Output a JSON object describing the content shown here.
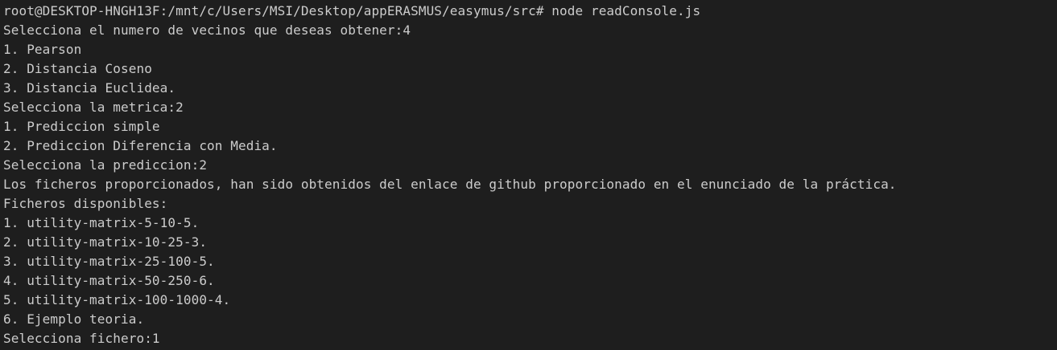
{
  "terminal": {
    "background": "#1e1e1e",
    "foreground": "#cccccc",
    "lines": [
      "root@DESKTOP-HNGH13F:/mnt/c/Users/MSI/Desktop/appERASMUS/easymus/src# node readConsole.js",
      "Selecciona el numero de vecinos que deseas obtener:4",
      "1. Pearson",
      "2. Distancia Coseno",
      "3. Distancia Euclidea.",
      "Selecciona la metrica:2",
      "1. Prediccion simple",
      "2. Prediccion Diferencia con Media.",
      "Selecciona la prediccion:2",
      "Los ficheros proporcionados, han sido obtenidos del enlace de github proporcionado en el enunciado de la práctica.",
      "Ficheros disponibles:",
      "1. utility-matrix-5-10-5.",
      "2. utility-matrix-10-25-3.",
      "3. utility-matrix-25-100-5.",
      "4. utility-matrix-50-250-6.",
      "5. utility-matrix-100-1000-4.",
      "6. Ejemplo teoria.",
      "Selecciona fichero:1"
    ]
  }
}
